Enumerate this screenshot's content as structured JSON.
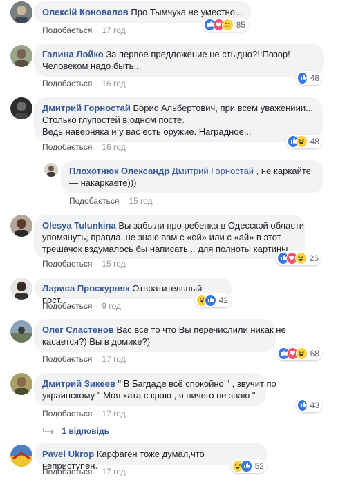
{
  "like_label": "Подобається",
  "comments": [
    {
      "name": "Олексій Коновалов",
      "lines": [
        "Про Тымчука не уместно..."
      ],
      "time": "17 год",
      "reactions": [
        "like",
        "love",
        "sad"
      ],
      "count": "85"
    },
    {
      "name": "Галина Лойко",
      "lines": [
        "За первое предложение не стыдно?!!Позор!",
        "Человеком надо быть..."
      ],
      "time": "16 год",
      "reactions": [
        "like"
      ],
      "count": "48"
    },
    {
      "name": "Дмитрий Горностай",
      "lines": [
        "Борис Альбертович, при всем уважениии...",
        "Столько глупостей в одном посте.",
        "Ведь наверняка и у вас есть оружие. Наградное..."
      ],
      "time": "16 год",
      "reactions": [
        "like",
        "haha"
      ],
      "count": "48"
    },
    {
      "name": "Плохотнюк Олександр",
      "mention": "Дмитрий Горностай",
      "lines": [
        ", не каркайте",
        "— накаркаете)))"
      ],
      "time": "15 год"
    },
    {
      "name": "Olesya Tulunkina",
      "lines": [
        "Вы забыли про ребенка в Одесской области",
        "упомянуть, правда, не знаю вам с «ой» или с «ай» в этот",
        "трешачок вздумалось бы написать... для полноты картины..."
      ],
      "time": "15 год",
      "reactions": [
        "like",
        "love",
        "haha"
      ],
      "count": "26"
    },
    {
      "name": "Лариса Проскурняк",
      "lines": [
        "Отвратительный пост."
      ],
      "time": "9 год",
      "reactions": [
        "wow",
        "like"
      ],
      "count": "42"
    },
    {
      "name": "Олег Сластенов",
      "lines": [
        "Вас всё то что Вы перечислили никак не",
        "касается?) Вы в домике?)"
      ],
      "time": "17 год",
      "reactions": [
        "like",
        "love",
        "haha"
      ],
      "count": "68"
    },
    {
      "name": "Дмитрий Зикеев",
      "lines": [
        "\" В Багдаде всё спокойно \" , звучит по",
        "украинскому \" Моя хата с краю , я ничего не знаю \""
      ],
      "time": "17 год",
      "reactions": [
        "like"
      ],
      "count": "43"
    },
    {
      "name": "Pavel Ukrop",
      "lines": [
        "Карфаген тоже думал,что неприступен."
      ],
      "time": "17 год",
      "reactions": [
        "haha",
        "like"
      ],
      "count": "52"
    }
  ],
  "replies_link": "1 відповідь"
}
